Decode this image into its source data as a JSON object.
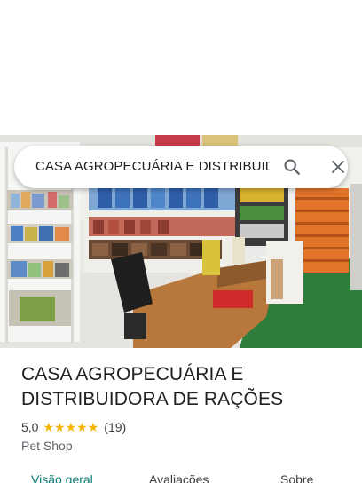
{
  "search": {
    "query": "CASA AGROPECUÁRIA E DISTRIBUIDORA DE RAÇÕES",
    "search_icon": "search-icon",
    "close_icon": "close-icon"
  },
  "photo": {
    "icon": "store-interior-photo"
  },
  "place": {
    "title": "CASA AGROPECUÁRIA E DISTRIBUIDORA DE RAÇÕES",
    "rating": "5,0",
    "stars": 5,
    "reviews": "(19)",
    "category": "Pet Shop"
  },
  "tabs": [
    {
      "label": "Visão geral"
    },
    {
      "label": "Avaliações"
    },
    {
      "label": "Sobre"
    }
  ],
  "colors": {
    "accent": "#0b7b74",
    "star": "#f4b400",
    "text": "#202124"
  }
}
